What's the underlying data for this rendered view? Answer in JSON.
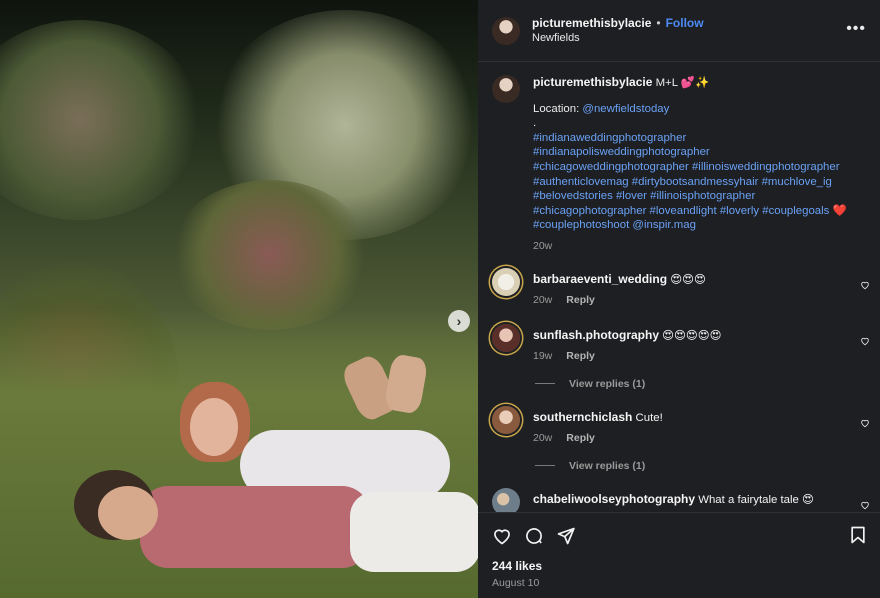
{
  "post": {
    "username": "picturemethisbylacie",
    "separator": "•",
    "follow_label": "Follow",
    "location": "Newfields"
  },
  "caption": {
    "username": "picturemethisbylacie",
    "title": "M+L 💕✨",
    "location_prefix": "Location: ",
    "location_tag": "@newfieldstoday",
    "dot_line": ".",
    "hashtags": [
      "#indianaweddingphotographer",
      "#indianapolisweddingphotographer",
      "#chicagoweddingphotographer #illinoisweddingphotographer",
      "#authenticlovemag #dirtybootsandmessyhair #muchlove_ig",
      "#belovedstories #lover #illinoisphotographer",
      "#chicagophotographer #loveandlight #loverly #couplegoals ❤️",
      "#couplephotoshoot @inspir.mag"
    ],
    "time": "20w"
  },
  "comments": [
    {
      "username": "barbaraeventi_wedding",
      "text": "😍😍😍",
      "time": "20w",
      "reply_label": "Reply",
      "replies": ""
    },
    {
      "username": "sunflash.photography",
      "text": "😍😍😍😍😍",
      "time": "19w",
      "reply_label": "Reply",
      "replies": "View replies (1)"
    },
    {
      "username": "southernchiclash",
      "text": "Cute!",
      "time": "20w",
      "reply_label": "Reply",
      "replies": "View replies (1)"
    },
    {
      "username": "chabeliwoolseyphotography",
      "text": "What a fairytale tale 😍",
      "time": "",
      "reply_label": "",
      "replies": ""
    }
  ],
  "footer": {
    "likes": "244 likes",
    "date": "August 10"
  },
  "icons": {
    "more": "more-options-icon",
    "like": "heart-icon",
    "comment": "comment-icon",
    "share": "share-icon",
    "save": "bookmark-icon",
    "next": "chevron-right-icon"
  },
  "colors": {
    "panel_bg": "#1e1f22",
    "link": "#4d8bf5",
    "hashtag": "#6aa1f5",
    "muted": "#9a9a9a"
  }
}
